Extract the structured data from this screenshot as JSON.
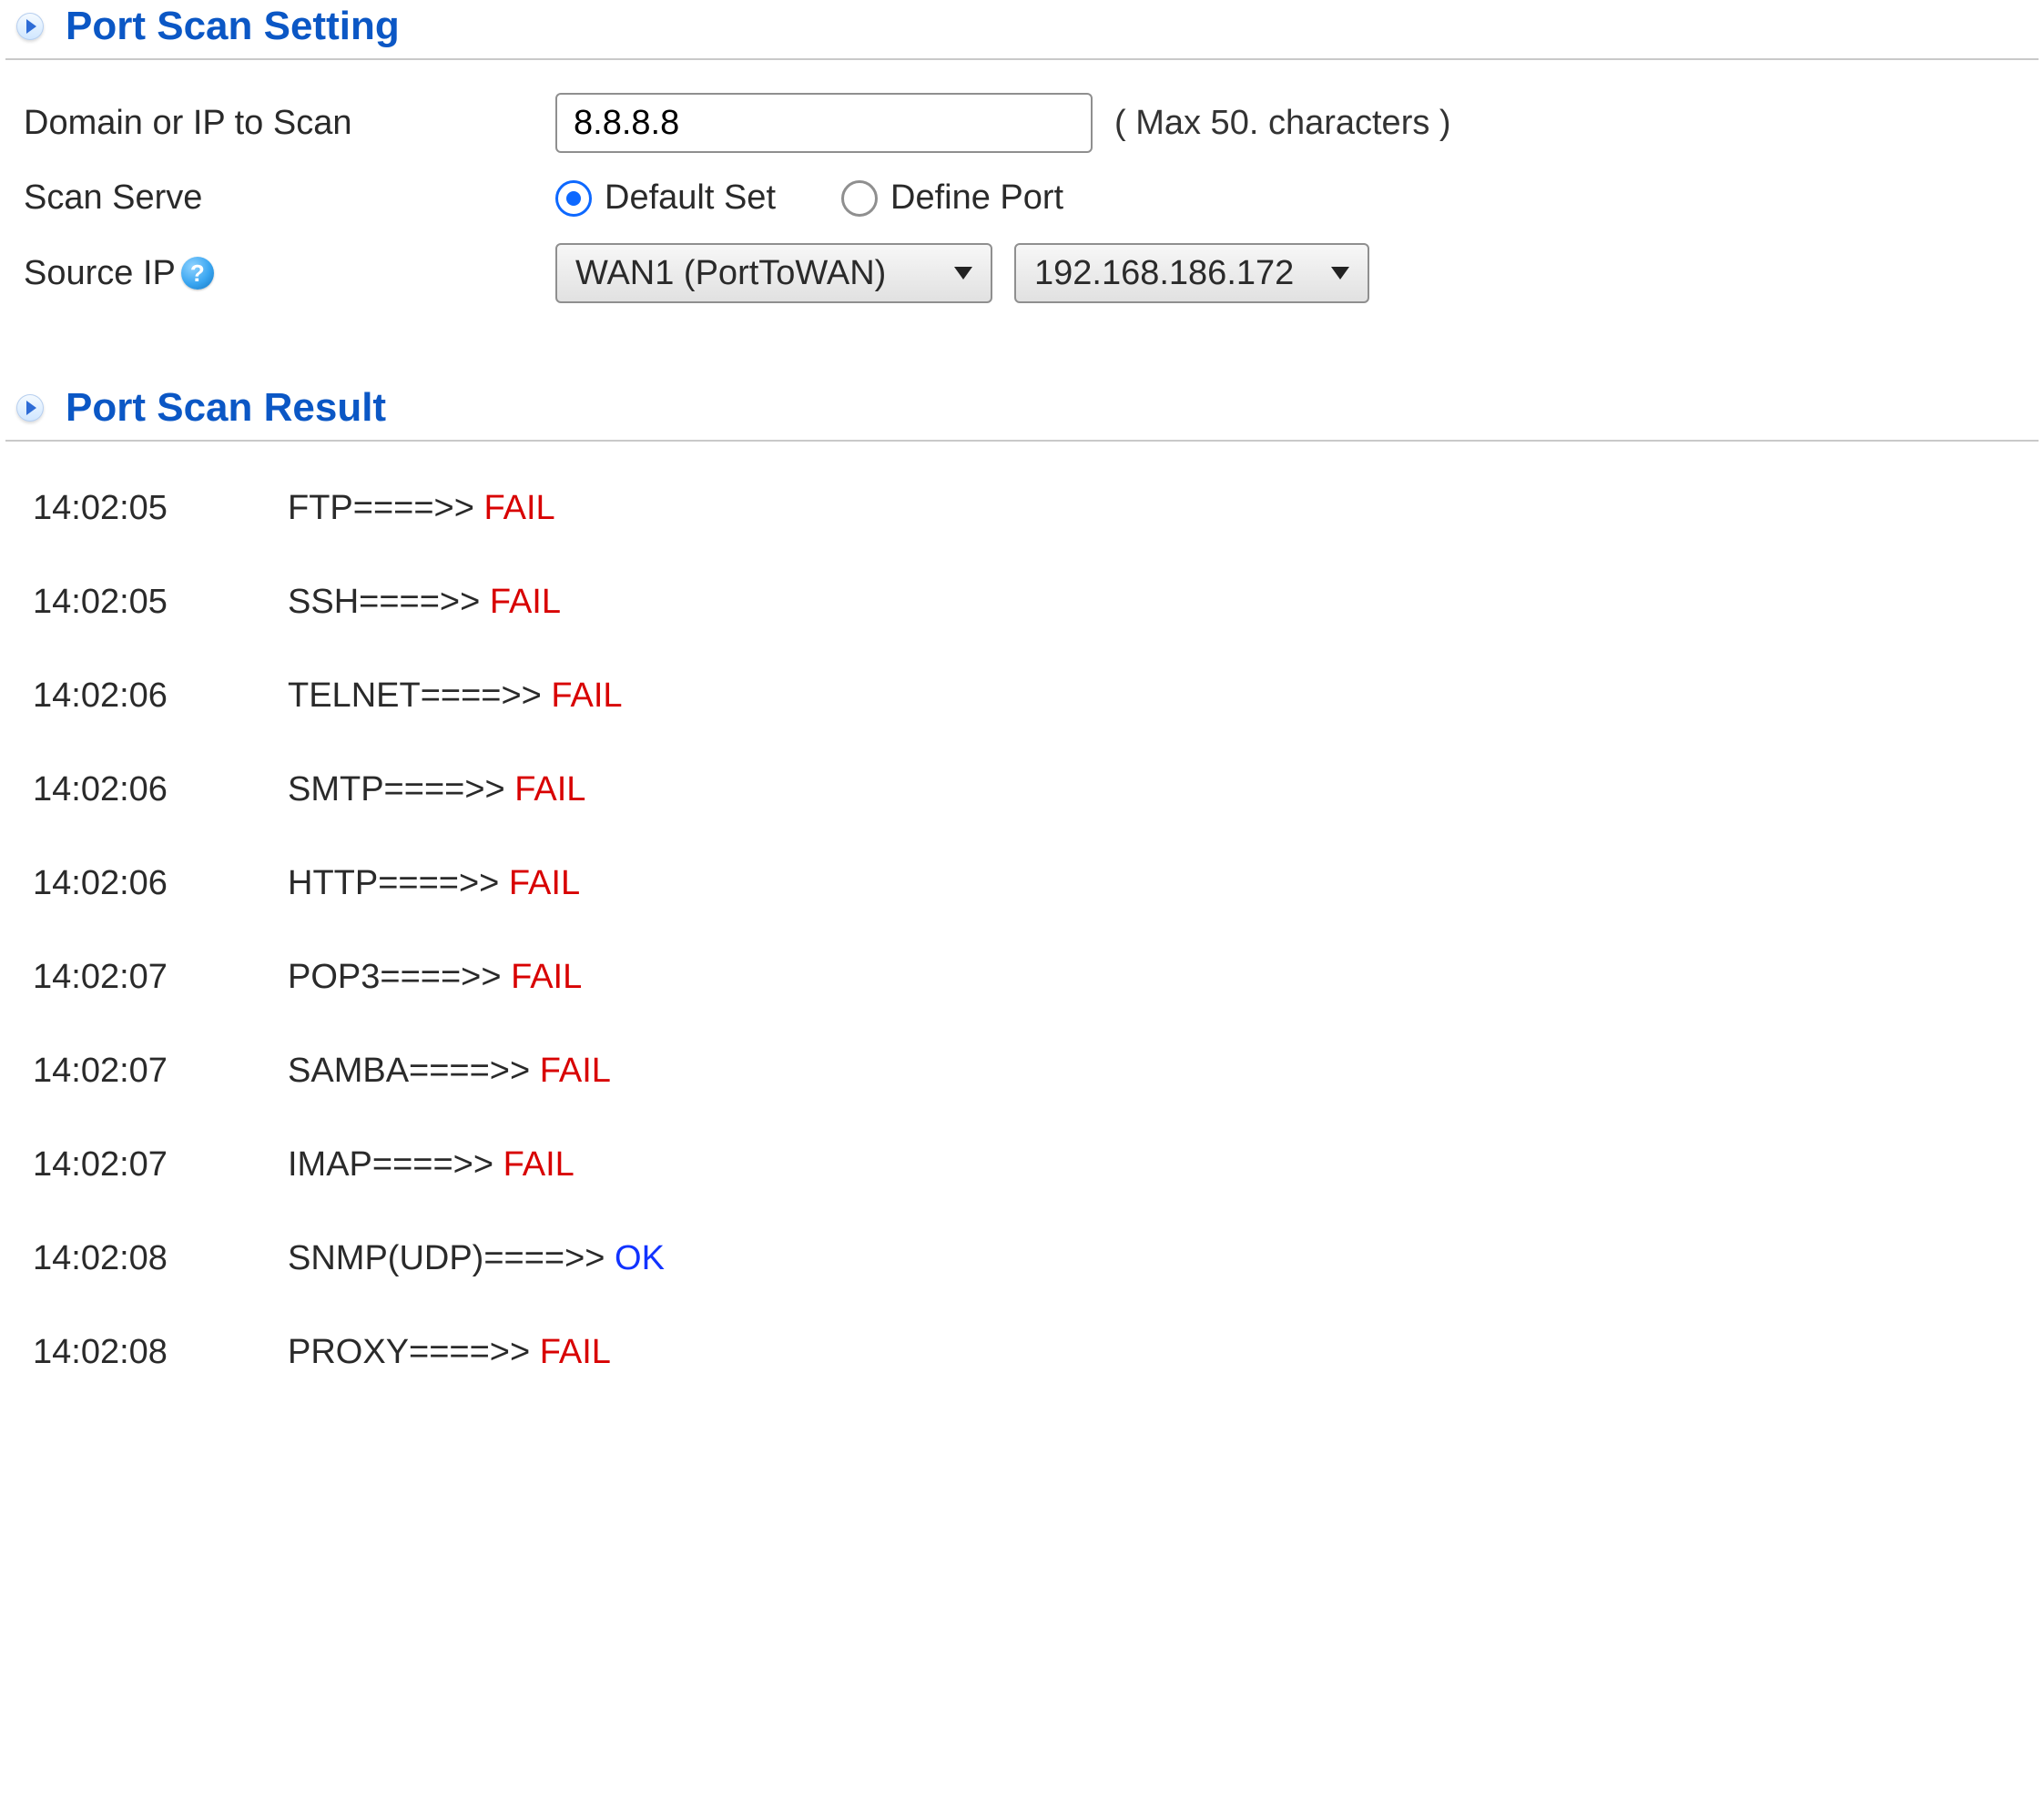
{
  "sections": {
    "settings_title": "Port Scan Setting",
    "results_title": "Port Scan Result"
  },
  "settings": {
    "domain_label": "Domain or IP to Scan",
    "domain_value": "8.8.8.8",
    "domain_hint": "( Max 50. characters )",
    "scan_serve_label": "Scan Serve",
    "scan_serve_options": {
      "default": "Default Set",
      "define": "Define Port"
    },
    "scan_serve_selected": "default",
    "source_ip_label": "Source IP",
    "source_interface_value": "WAN1 (PortToWAN)",
    "source_ip_value": "192.168.186.172",
    "help_tooltip": "?"
  },
  "arrow_sep": "====>> ",
  "statuses": {
    "fail": "FAIL",
    "ok": "OK"
  },
  "results": [
    {
      "time": "14:02:05",
      "service": "FTP",
      "status": "fail"
    },
    {
      "time": "14:02:05",
      "service": "SSH",
      "status": "fail"
    },
    {
      "time": "14:02:06",
      "service": "TELNET",
      "status": "fail"
    },
    {
      "time": "14:02:06",
      "service": "SMTP",
      "status": "fail"
    },
    {
      "time": "14:02:06",
      "service": "HTTP",
      "status": "fail"
    },
    {
      "time": "14:02:07",
      "service": "POP3",
      "status": "fail"
    },
    {
      "time": "14:02:07",
      "service": "SAMBA",
      "status": "fail"
    },
    {
      "time": "14:02:07",
      "service": "IMAP",
      "status": "fail"
    },
    {
      "time": "14:02:08",
      "service": "SNMP(UDP)",
      "status": "ok"
    },
    {
      "time": "14:02:08",
      "service": "PROXY",
      "status": "fail"
    }
  ]
}
